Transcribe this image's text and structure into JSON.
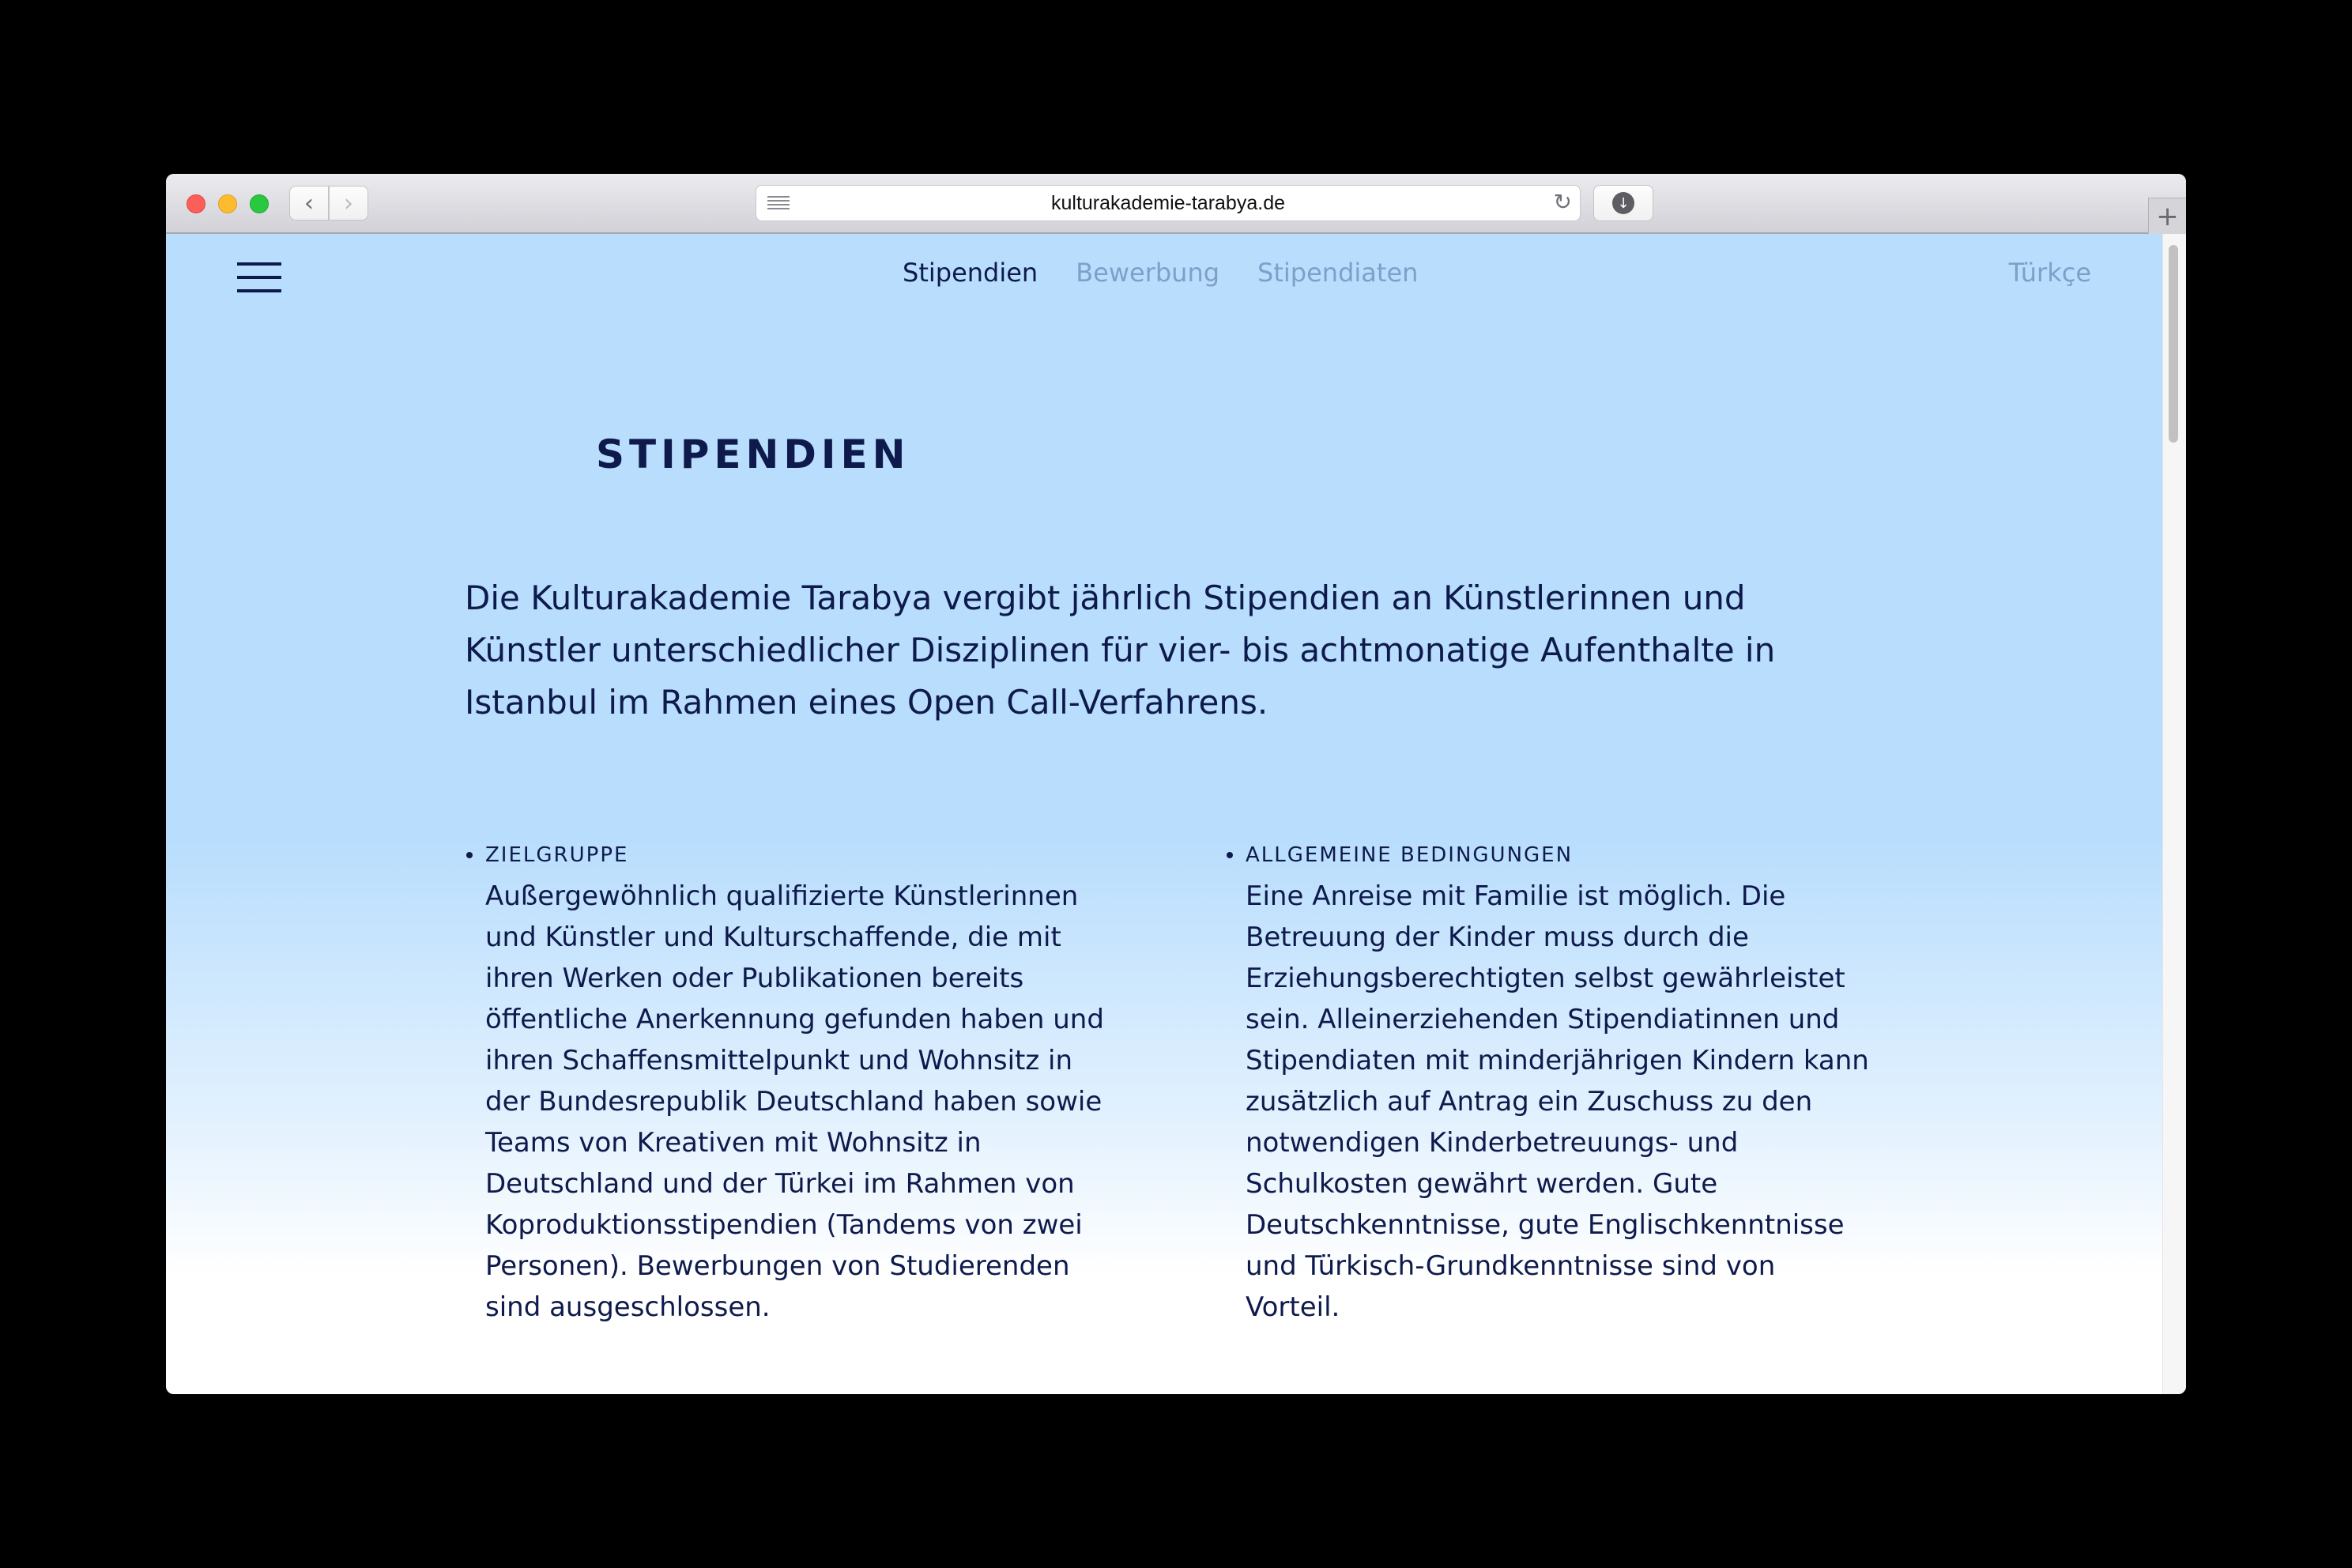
{
  "browser": {
    "url": "kulturakademie-tarabya.de"
  },
  "nav": {
    "items": [
      {
        "label": "Stipendien",
        "active": true
      },
      {
        "label": "Bewerbung",
        "active": false
      },
      {
        "label": "Stipendiaten",
        "active": false
      }
    ],
    "language": "Türkçe"
  },
  "main": {
    "title": "STIPENDIEN",
    "intro": "Die Kulturakademie Tarabya vergibt jährlich Stipendien an Künstlerinnen und Künstler unterschiedlicher Disziplinen für vier- bis achtmonatige Aufenthalte in Istanbul im Rahmen eines Open Call-Verfahrens.",
    "sections": [
      {
        "heading": "ZIELGRUPPE",
        "body": "Außergewöhnlich qualifizierte Künstlerinnen\nund Künstler und Kulturschaffende, die mit\nihren Werken oder Publikationen bereits\nöffentliche Anerkennung gefunden haben und\nihren Schaffensmittelpunkt und Wohnsitz in\nder Bundesrepublik Deutschland haben sowie\nTeams von Kreativen mit Wohnsitz in\nDeutschland und der Türkei im Rahmen von\nKoproduktionsstipendien (Tandems von zwei\nPersonen). Bewerbungen von Studierenden\nsind ausgeschlossen."
      },
      {
        "heading": "ALLGEMEINE BEDINGUNGEN",
        "body": "Eine Anreise mit Familie ist möglich. Die\nBetreuung der Kinder muss durch die\nErziehungsberechtigten selbst gewährleistet\nsein. Alleinerziehenden Stipendiatinnen und\nStipendiaten mit minderjährigen Kindern kann\nzusätzlich auf Antrag ein Zuschuss zu den\nnotwendigen Kinderbetreuungs- und\nSchulkosten gewährt werden. Gute\nDeutschkenntnisse, gute Englischkenntnisse\nund Türkisch-Grundkenntnisse sind von\nVorteil."
      }
    ]
  },
  "colors": {
    "page_background": "#b8ddfd",
    "text": "#0e1a4b",
    "nav_inactive": "#7f9fc8"
  },
  "icons": {
    "menu": "hamburger-menu-icon",
    "back": "chevron-left-icon",
    "forward": "chevron-right-icon",
    "reader": "reader-icon",
    "reload": "reload-icon",
    "download": "download-icon",
    "new_tab": "plus-icon"
  }
}
